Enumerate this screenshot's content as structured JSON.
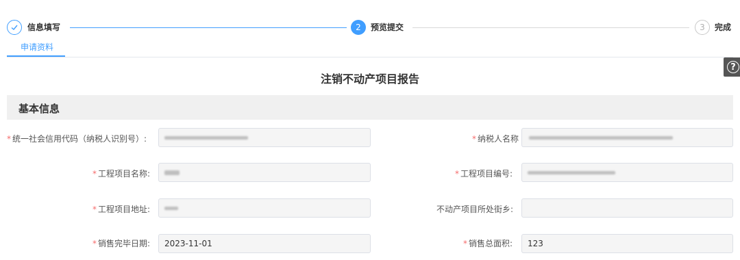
{
  "steps": [
    {
      "index": "✓",
      "label": "信息填写",
      "state": "done"
    },
    {
      "index": "2",
      "label": "预览提交",
      "state": "active"
    },
    {
      "index": "3",
      "label": "完成",
      "state": "todo"
    }
  ],
  "tabs": [
    {
      "label": "申请资料",
      "active": true
    }
  ],
  "help": {
    "icon": "help-question-icon",
    "glyph": "?"
  },
  "report_title": "注销不动产项目报告",
  "section": {
    "title": "基本信息"
  },
  "fields": {
    "credit_code": {
      "label": "统一社会信用代码（纳税人识别号）:",
      "required": true,
      "value": ""
    },
    "taxpayer_name": {
      "label": "纳税人名称",
      "required": true,
      "value": ""
    },
    "project_name": {
      "label": "工程项目名称:",
      "required": true,
      "value": ""
    },
    "project_no": {
      "label": "工程项目编号:",
      "required": true,
      "value": ""
    },
    "project_addr": {
      "label": "工程项目地址:",
      "required": true,
      "value": ""
    },
    "street": {
      "label": "不动产项目所处街乡:",
      "required": false,
      "value": ""
    },
    "sale_end_date": {
      "label": "销售完毕日期:",
      "required": true,
      "value": "2023-11-01"
    },
    "sale_total_area": {
      "label": "销售总面积:",
      "required": true,
      "value": "123"
    }
  },
  "required_mark": "*",
  "colors": {
    "accent": "#409eff",
    "required": "#f56c6c",
    "section_bg": "#f0f0f0",
    "input_bg": "#f5f5f5"
  }
}
